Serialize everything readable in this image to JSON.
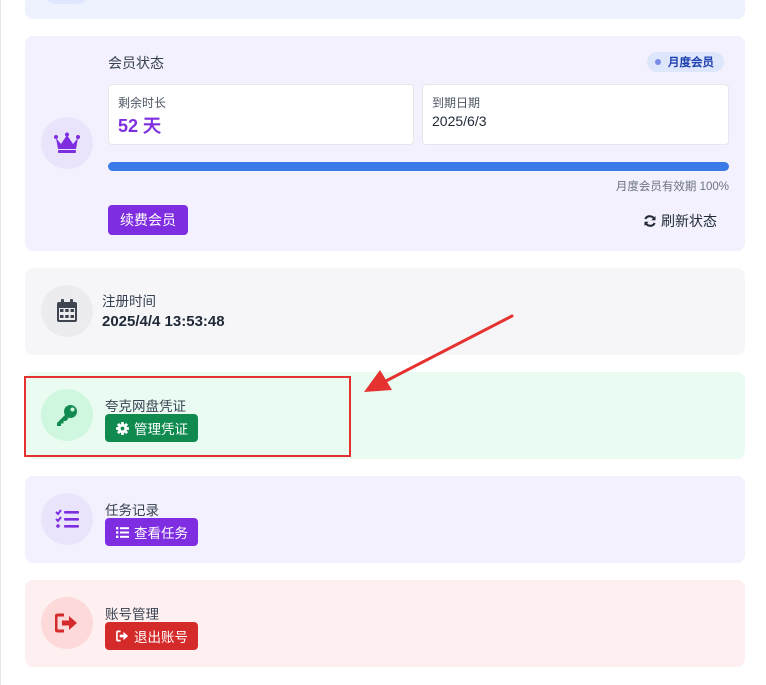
{
  "membership": {
    "title": "会员状态",
    "badge": "月度会员",
    "remaining_label": "剩余时长",
    "remaining_value": "52 天",
    "expiry_label": "到期日期",
    "expiry_value": "2025/6/3",
    "progress_percent": 100,
    "progress_text": "月度会员有效期 100%",
    "renew_button": "续费会员",
    "refresh_button": "刷新状态"
  },
  "register": {
    "title": "注册时间",
    "value": "2025/4/4 13:53:48"
  },
  "credential": {
    "title": "夸克网盘凭证",
    "button": "管理凭证"
  },
  "tasks": {
    "title": "任务记录",
    "button": "查看任务"
  },
  "account": {
    "title": "账号管理",
    "button": "退出账号"
  },
  "colors": {
    "purple": "#7e2ee0",
    "green": "#108a4f",
    "red": "#d42a2a",
    "blue": "#3b7be8",
    "annotation": "#e5312f"
  },
  "icons": [
    "crown-icon",
    "calendar-icon",
    "key-icon",
    "gear-icon",
    "task-list-icon",
    "list-icon",
    "logout-icon",
    "refresh-icon"
  ]
}
